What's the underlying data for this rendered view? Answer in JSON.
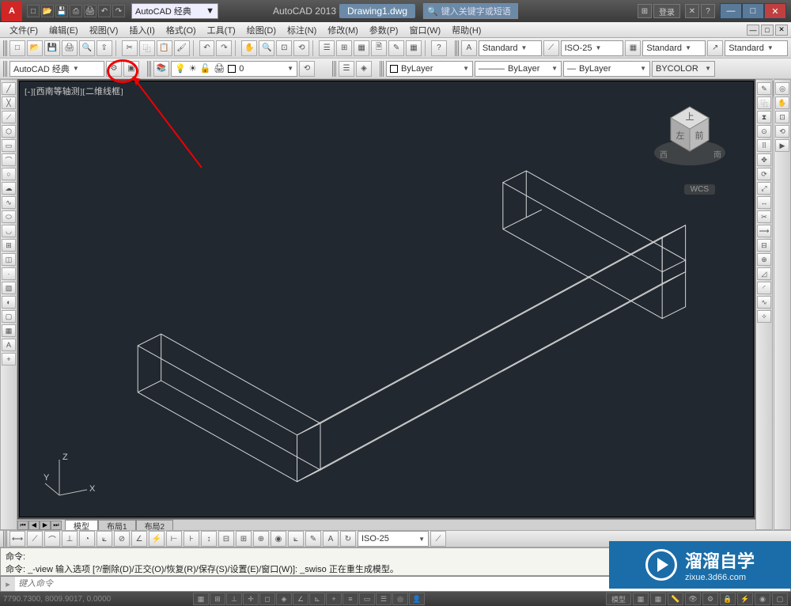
{
  "title": {
    "workspace_dropdown": "AutoCAD 经典",
    "app": "AutoCAD 2013",
    "file": "Drawing1.dwg",
    "search_placeholder": "键入关键字或短语",
    "login": "登录"
  },
  "menu": {
    "items": [
      "文件(F)",
      "编辑(E)",
      "视图(V)",
      "插入(I)",
      "格式(O)",
      "工具(T)",
      "绘图(D)",
      "标注(N)",
      "修改(M)",
      "参数(P)",
      "窗口(W)",
      "帮助(H)"
    ]
  },
  "toolbar1": {
    "std1": "Standard",
    "iso": "ISO-25",
    "std2": "Standard",
    "std3": "Standard"
  },
  "toolbar2": {
    "workspace": "AutoCAD 经典",
    "layer": "0",
    "bylayer1": "ByLayer",
    "bylayer2": "ByLayer",
    "bylayer3": "ByLayer",
    "bycolor": "BYCOLOR"
  },
  "view": {
    "label": "[-][西南等轴测][二维线框]",
    "wcs": "WCS",
    "ucs_z": "Z",
    "ucs_y": "Y",
    "ucs_x": "X",
    "cube_top": "上",
    "cube_left": "左",
    "cube_front": "前",
    "cube_w": "西",
    "cube_s": "南"
  },
  "tabs": {
    "model": "模型",
    "layout1": "布局1",
    "layout2": "布局2"
  },
  "dim": {
    "iso": "ISO-25"
  },
  "cmd": {
    "line1": "命令:",
    "line2": "命令: _-view 输入选项 [?/删除(D)/正交(O)/恢复(R)/保存(S)/设置(E)/窗口(W)]: _swiso 正在重生成模型。",
    "placeholder": "键入命令"
  },
  "status": {
    "coord": "7790.7300, 8009.9017, 0.0000",
    "model": "模型"
  },
  "watermark": {
    "big": "溜溜自学",
    "small": "zixue.3d66.com"
  }
}
